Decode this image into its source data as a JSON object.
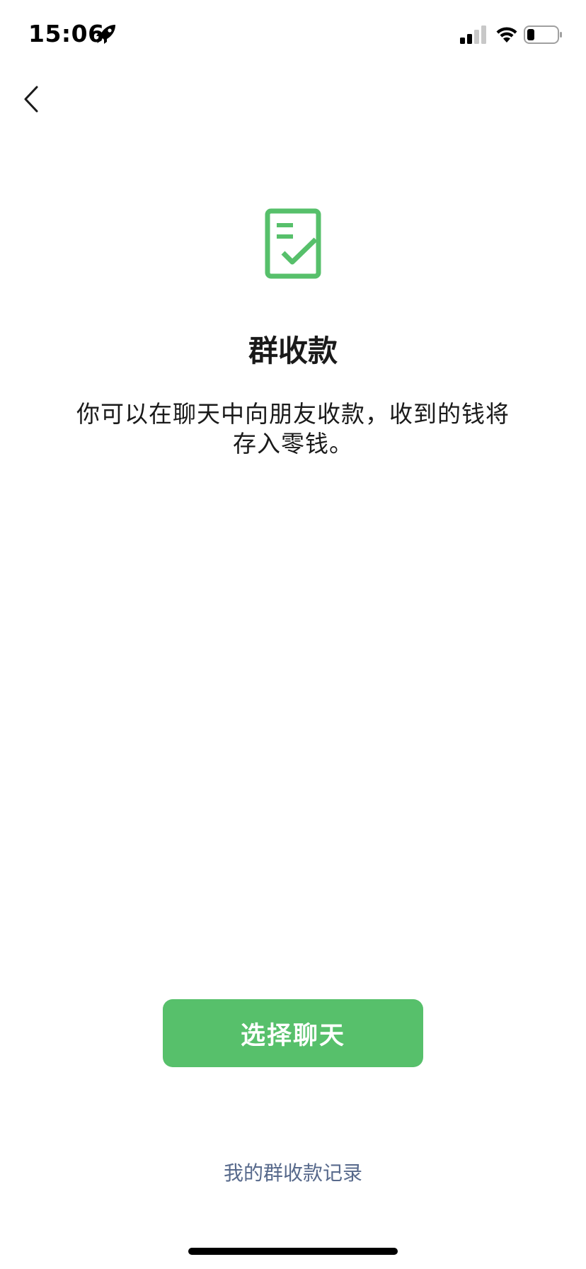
{
  "status_bar": {
    "time": "15:06",
    "icons": [
      "rocket-icon",
      "signal-icon",
      "wifi-icon",
      "battery-icon"
    ]
  },
  "nav": {
    "back_icon": "chevron-left-icon"
  },
  "hero": {
    "icon": "checklist-document-icon",
    "title": "群收款",
    "description": "你可以在聊天中向朋友收款，收到的钱将存入零钱。"
  },
  "actions": {
    "primary_button_label": "选择聊天",
    "records_link_label": "我的群收款记录"
  },
  "colors": {
    "accent_green": "#57c06b",
    "link_blue_gray": "#586a8c",
    "text_primary": "#1a1a1a",
    "background": "#ffffff"
  }
}
